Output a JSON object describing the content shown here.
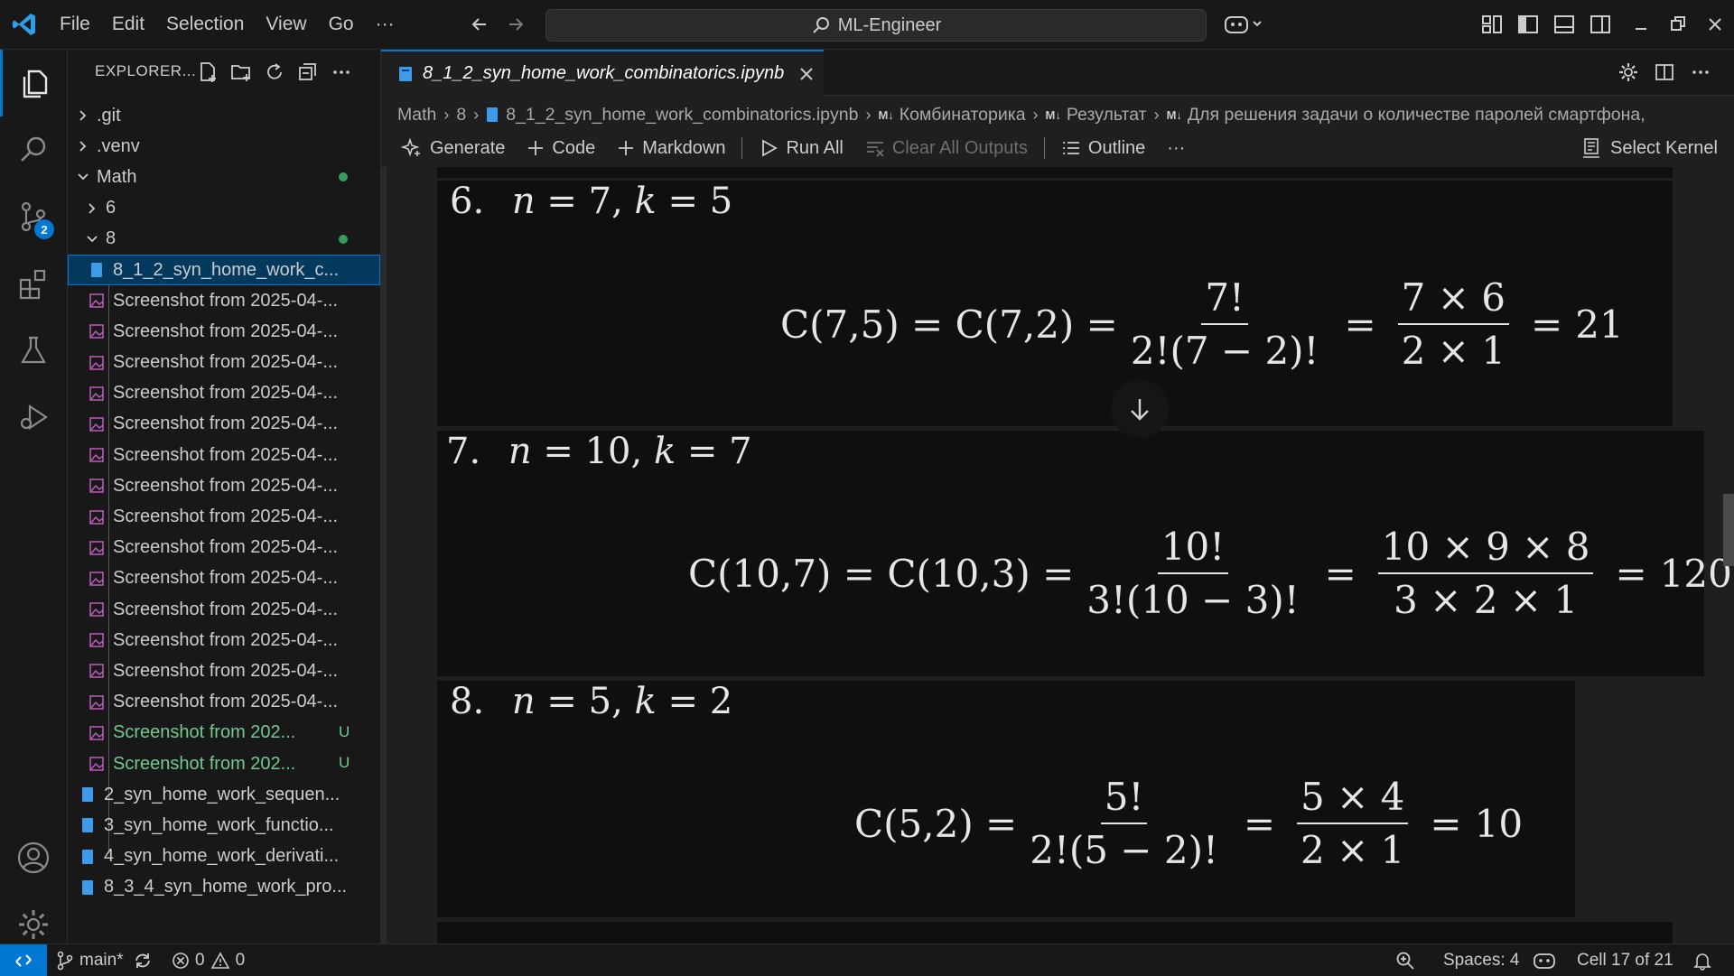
{
  "titlebar": {
    "menu": [
      "File",
      "Edit",
      "Selection",
      "View",
      "Go",
      "···"
    ],
    "search_text": "ML-Engineer"
  },
  "activitybar": {
    "items": [
      "explorer-icon",
      "search-icon",
      "source-control-icon",
      "extensions-icon",
      "testing-icon",
      "run-debug-icon"
    ],
    "source_control_badge": "2",
    "bottom": [
      "account-icon",
      "settings-gear-icon"
    ]
  },
  "sidebar": {
    "title": "EXPLORER...",
    "tree": [
      {
        "label": ".git",
        "kind": "folder",
        "expanded": false,
        "depth": 0
      },
      {
        "label": ".venv",
        "kind": "folder",
        "expanded": false,
        "depth": 0
      },
      {
        "label": "Math",
        "kind": "folder",
        "expanded": true,
        "depth": 0,
        "modified": true
      },
      {
        "label": "6",
        "kind": "folder",
        "expanded": false,
        "depth": 1
      },
      {
        "label": "8",
        "kind": "folder",
        "expanded": true,
        "depth": 1,
        "modified": true
      },
      {
        "label": "8_1_2_syn_home_work_c...",
        "kind": "notebook",
        "depth": 2,
        "selected": true
      },
      {
        "label": "Screenshot from 2025-04-...",
        "kind": "image",
        "depth": 2
      },
      {
        "label": "Screenshot from 2025-04-...",
        "kind": "image",
        "depth": 2
      },
      {
        "label": "Screenshot from 2025-04-...",
        "kind": "image",
        "depth": 2
      },
      {
        "label": "Screenshot from 2025-04-...",
        "kind": "image",
        "depth": 2
      },
      {
        "label": "Screenshot from 2025-04-...",
        "kind": "image",
        "depth": 2
      },
      {
        "label": "Screenshot from 2025-04-...",
        "kind": "image",
        "depth": 2
      },
      {
        "label": "Screenshot from 2025-04-...",
        "kind": "image",
        "depth": 2
      },
      {
        "label": "Screenshot from 2025-04-...",
        "kind": "image",
        "depth": 2
      },
      {
        "label": "Screenshot from 2025-04-...",
        "kind": "image",
        "depth": 2
      },
      {
        "label": "Screenshot from 2025-04-...",
        "kind": "image",
        "depth": 2
      },
      {
        "label": "Screenshot from 2025-04-...",
        "kind": "image",
        "depth": 2
      },
      {
        "label": "Screenshot from 2025-04-...",
        "kind": "image",
        "depth": 2
      },
      {
        "label": "Screenshot from 2025-04-...",
        "kind": "image",
        "depth": 2
      },
      {
        "label": "Screenshot from 2025-04-...",
        "kind": "image",
        "depth": 2
      },
      {
        "label": "Screenshot from 202...",
        "kind": "image",
        "depth": 2,
        "untracked": true,
        "badge": "U"
      },
      {
        "label": "Screenshot from 202...",
        "kind": "image",
        "depth": 2,
        "untracked": true,
        "badge": "U"
      },
      {
        "label": "2_syn_home_work_sequen...",
        "kind": "notebook",
        "depth": 1
      },
      {
        "label": "3_syn_home_work_functio...",
        "kind": "notebook",
        "depth": 1
      },
      {
        "label": "4_syn_home_work_derivati...",
        "kind": "notebook",
        "depth": 1
      },
      {
        "label": "8_3_4_syn_home_work_pro...",
        "kind": "notebook",
        "depth": 1
      }
    ]
  },
  "editor": {
    "tab_label": "8_1_2_syn_home_work_combinatorics.ipynb",
    "breadcrumb": {
      "b0": "Math",
      "b1": "8",
      "b2": "8_1_2_syn_home_work_combinatorics.ipynb",
      "md": "M↓",
      "b3": "Комбинаторика",
      "b4": "Результат",
      "b5": "Для решения задачи о количестве паролей смартфона,"
    },
    "toolbar": {
      "generate": "Generate",
      "code": "Code",
      "markdown": "Markdown",
      "run_all": "Run All",
      "clear_outputs": "Clear All Outputs",
      "outline": "Outline",
      "more": "···",
      "select_kernel": "Select Kernel"
    },
    "cells": [
      {
        "num": "6.",
        "n": "7",
        "k": "5",
        "lhs": "C(7,5) = C(7,2) =",
        "frac1_num": "7!",
        "frac1_den": "2!(7 − 2)!",
        "frac2_num": "7 × 6",
        "frac2_den": "2 × 1",
        "result": "21"
      },
      {
        "num": "7.",
        "n": "10",
        "k": "7",
        "lhs": "C(10,7) = C(10,3) =",
        "frac1_num": "10!",
        "frac1_den": "3!(10 − 3)!",
        "frac2_num": "10 × 9 × 8",
        "frac2_den": "3 × 2 × 1",
        "result": "120"
      },
      {
        "num": "8.",
        "n": "5",
        "k": "2",
        "lhs": "C(5,2) =",
        "frac1_num": "5!",
        "frac1_den": "2!(5 − 2)!",
        "frac2_num": "5 × 4",
        "frac2_den": "2 × 1",
        "result": "10"
      }
    ]
  },
  "statusbar": {
    "branch": "main*",
    "errors": "0",
    "warnings": "0",
    "spaces": "Spaces: 4",
    "cell_position": "Cell 17 of 21"
  },
  "colors": {
    "accent": "#0078d4",
    "untracked": "#73c991",
    "background": "#1f1f1f",
    "cell_background": "#0f0f0f"
  }
}
